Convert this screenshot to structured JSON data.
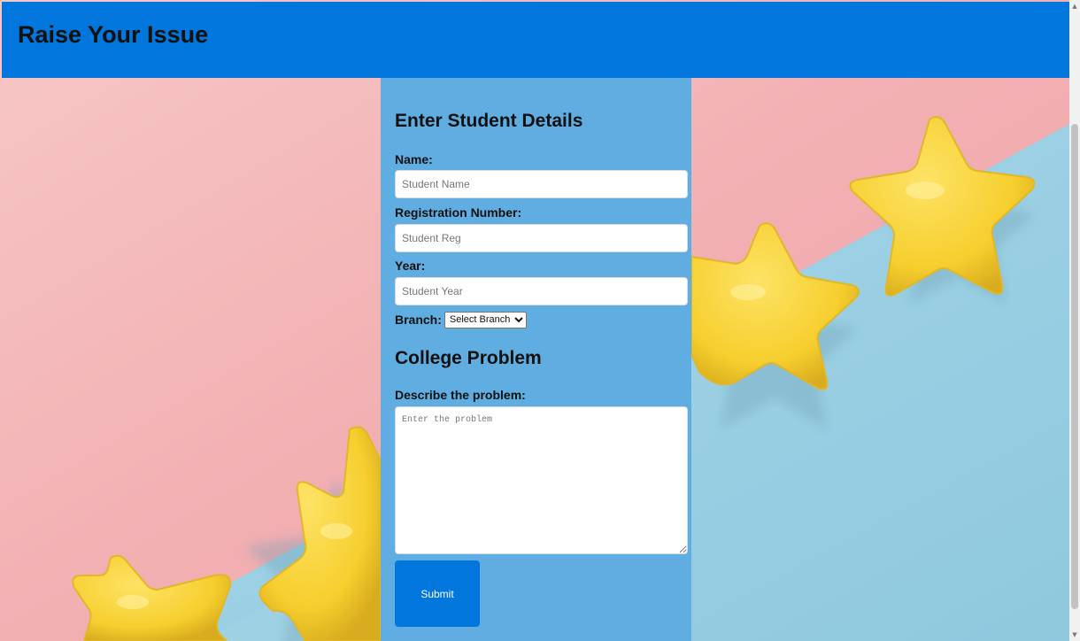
{
  "header": {
    "title": "Raise Your Issue"
  },
  "form": {
    "student_section_title": "Enter Student Details",
    "name": {
      "label": "Name:",
      "placeholder": "Student Name",
      "value": ""
    },
    "registration": {
      "label": "Registration Number:",
      "placeholder": "Student Reg",
      "value": ""
    },
    "year": {
      "label": "Year:",
      "placeholder": "Student Year",
      "value": ""
    },
    "branch": {
      "label": "Branch:",
      "selected": "Select Branch"
    },
    "problem_section_title": "College Problem",
    "problem": {
      "label": "Describe the problem:",
      "placeholder": "Enter the problem",
      "value": ""
    },
    "submit_label": "Submit"
  },
  "colors": {
    "header": "#0176dc",
    "panel": "#60ade2",
    "submit": "#0176dc",
    "bg_pink": "#f4b3b5",
    "bg_blue": "#9ccfe2",
    "star": "#f9d43b"
  },
  "icons": {
    "scroll_up": "scroll-up-arrow-icon",
    "scroll_down": "scroll-down-arrow-icon",
    "select_chevron": "chevron-down-icon"
  }
}
